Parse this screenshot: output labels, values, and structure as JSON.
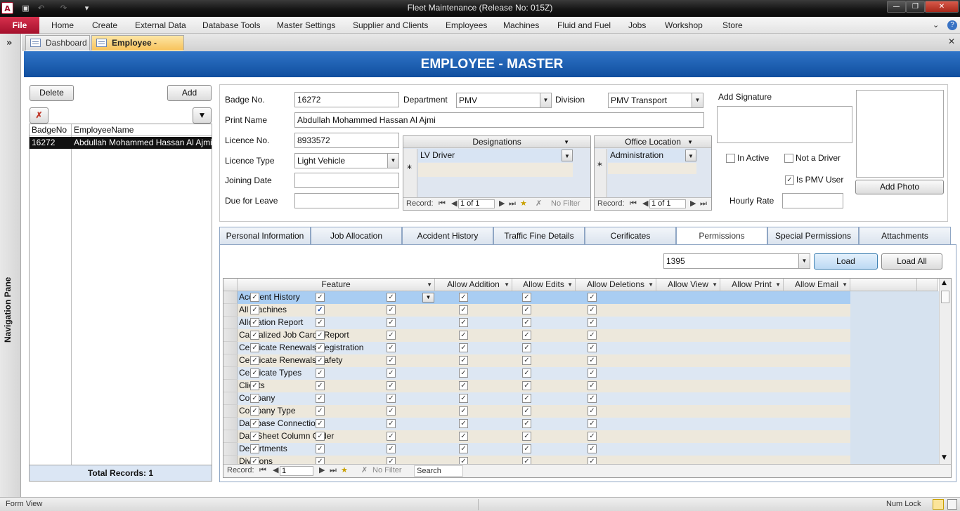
{
  "window": {
    "title": "Fleet Maintenance (Release No: 015Z)"
  },
  "ribbon": {
    "file": "File",
    "tabs": [
      "Home",
      "Create",
      "External Data",
      "Database Tools",
      "Master Settings",
      "Supplier and Clients",
      "Employees",
      "Machines",
      "Fluid and Fuel",
      "Jobs",
      "Workshop",
      "Store"
    ]
  },
  "nav_pane": {
    "label": "Navigation Pane"
  },
  "doc_tabs": [
    {
      "label": "Dashboard"
    },
    {
      "label": "Employee - Master"
    }
  ],
  "form_title": "EMPLOYEE - MASTER",
  "left": {
    "delete": "Delete",
    "add": "Add",
    "col_badge": "BadgeNo",
    "col_name": "EmployeeName",
    "rows": [
      {
        "badge": "16272",
        "name": "Abdullah Mohammed Hassan Al Ajmi"
      }
    ],
    "total": "Total Records: 1"
  },
  "fields": {
    "badge_label": "Badge No.",
    "badge_value": "16272",
    "department_label": "Department",
    "department_value": "PMV",
    "division_label": "Division",
    "division_value": "PMV Transport",
    "print_name_label": "Print Name",
    "print_name_value": "Abdullah Mohammed Hassan Al Ajmi",
    "licence_no_label": "Licence No.",
    "licence_no_value": "8933572",
    "licence_type_label": "Licence Type",
    "licence_type_value": "Light Vehicle",
    "joining_label": "Joining Date",
    "joining_value": "",
    "leave_label": "Due for Leave",
    "leave_value": "",
    "signature_label": "Add Signature",
    "inactive_label": "In Active",
    "inactive_checked": false,
    "notdriver_label": "Not a Driver",
    "notdriver_checked": false,
    "pmvuser_label": "Is PMV User",
    "pmvuser_checked": true,
    "hourly_label": "Hourly Rate",
    "hourly_value": "",
    "add_photo": "Add Photo"
  },
  "designations": {
    "header": "Designations",
    "value": "LV Driver",
    "nav": {
      "record": "Record:",
      "pos": "1 of 1",
      "filter": "No Filter"
    }
  },
  "office": {
    "header": "Office Location",
    "value": "Administration",
    "nav": {
      "record": "Record:",
      "pos": "1 of 1"
    }
  },
  "tabs": [
    "Personal Information",
    "Job Allocation",
    "Accident History",
    "Traffic Fine Details",
    "Cerificates",
    "Permissions",
    "Special Permissions",
    "Attachments"
  ],
  "permissions": {
    "user_value": "1395",
    "load": "Load",
    "load_all": "Load All",
    "columns": [
      "Feature",
      "Allow Addition",
      "Allow Edits",
      "Allow Deletions",
      "Allow View",
      "Allow Print",
      "Allow Email"
    ],
    "rows": [
      {
        "feature": "Accident History",
        "vals": [
          true,
          true,
          true,
          true,
          true,
          true
        ]
      },
      {
        "feature": "All Machines",
        "vals": [
          true,
          true,
          true,
          true,
          true,
          true
        ],
        "highlight_edit": true
      },
      {
        "feature": "Allocation Report",
        "vals": [
          true,
          true,
          true,
          true,
          true,
          true
        ]
      },
      {
        "feature": "Capitalized Job Cards Report",
        "vals": [
          true,
          true,
          true,
          true,
          true,
          true
        ]
      },
      {
        "feature": "Certificate Renewals Registration",
        "vals": [
          true,
          true,
          true,
          true,
          true,
          true
        ]
      },
      {
        "feature": "Certificate Renewals Safety",
        "vals": [
          true,
          true,
          true,
          true,
          true,
          true
        ]
      },
      {
        "feature": "Certificate Types",
        "vals": [
          true,
          true,
          true,
          true,
          true,
          true
        ]
      },
      {
        "feature": "Clients",
        "vals": [
          true,
          true,
          true,
          true,
          true,
          true
        ]
      },
      {
        "feature": "Company",
        "vals": [
          true,
          true,
          true,
          true,
          true,
          true
        ]
      },
      {
        "feature": "Company Type",
        "vals": [
          true,
          true,
          true,
          true,
          true,
          true
        ]
      },
      {
        "feature": "Database Connection",
        "vals": [
          true,
          true,
          true,
          true,
          true,
          true
        ]
      },
      {
        "feature": "DataSheet Column Order",
        "vals": [
          true,
          true,
          true,
          true,
          true,
          true
        ]
      },
      {
        "feature": "Departments",
        "vals": [
          true,
          true,
          true,
          true,
          true,
          true
        ]
      },
      {
        "feature": "Divisions",
        "vals": [
          true,
          true,
          true,
          true,
          true,
          true
        ]
      }
    ],
    "nav": {
      "record": "Record:",
      "pos": "1",
      "filter": "No Filter",
      "search": "Search"
    }
  },
  "status": {
    "left": "Form View",
    "right": "Num Lock"
  }
}
